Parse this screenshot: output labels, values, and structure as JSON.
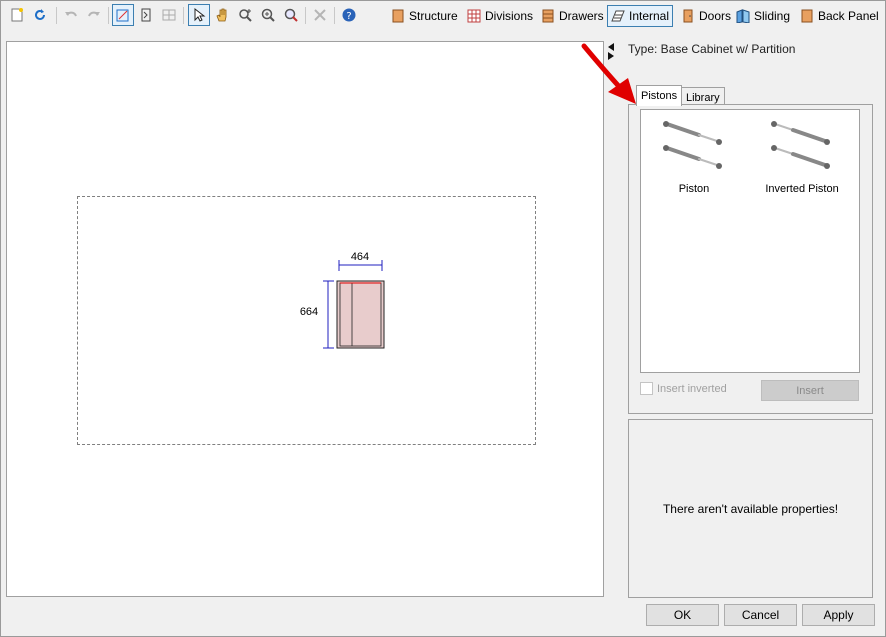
{
  "toolbar": {
    "buttons": [
      "Structure",
      "Divisions",
      "Drawers",
      "Internal",
      "Doors",
      "Sliding",
      "Back Panel"
    ],
    "active_button": "Internal"
  },
  "canvas": {
    "width_dimension": "464",
    "height_dimension": "664"
  },
  "type_label": "Type: Base Cabinet w/ Partition",
  "tabs": [
    "Pistons",
    "Library"
  ],
  "pistons": {
    "items": [
      {
        "label": "Piston"
      },
      {
        "label": "Inverted Piston"
      }
    ],
    "insert_inverted_label": "Insert inverted",
    "insert_label": "Insert"
  },
  "properties": {
    "empty_message": "There aren't available properties!"
  },
  "dialog": {
    "ok": "OK",
    "cancel": "Cancel",
    "apply": "Apply"
  },
  "colors": {
    "accent_blue": "#3c7fb1",
    "annotation_red": "#e00000",
    "cabinet_fill": "#e8cccc",
    "dimension_blue": "#1f1fbf"
  }
}
